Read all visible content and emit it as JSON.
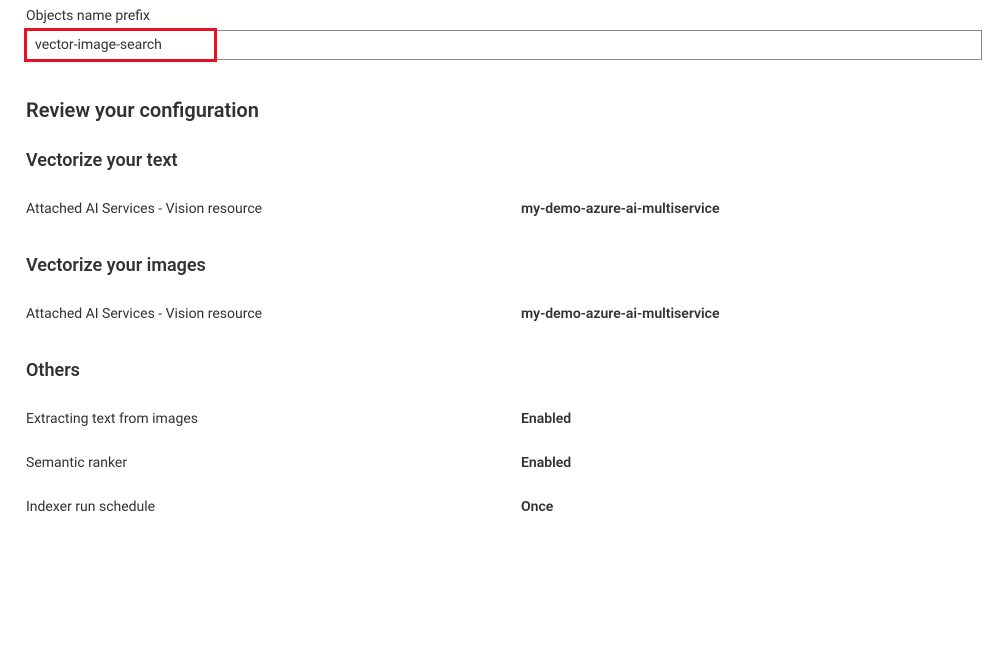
{
  "prefix_field": {
    "label": "Objects name prefix",
    "value": "vector-image-search"
  },
  "review_heading": "Review your configuration",
  "sections": {
    "vectorize_text": {
      "heading": "Vectorize your text",
      "rows": [
        {
          "label": "Attached AI Services - Vision resource",
          "value": "my-demo-azure-ai-multiservice"
        }
      ]
    },
    "vectorize_images": {
      "heading": "Vectorize your images",
      "rows": [
        {
          "label": "Attached AI Services - Vision resource",
          "value": "my-demo-azure-ai-multiservice"
        }
      ]
    },
    "others": {
      "heading": "Others",
      "rows": [
        {
          "label": "Extracting text from images",
          "value": "Enabled"
        },
        {
          "label": "Semantic ranker",
          "value": "Enabled"
        },
        {
          "label": "Indexer run schedule",
          "value": "Once"
        }
      ]
    }
  }
}
